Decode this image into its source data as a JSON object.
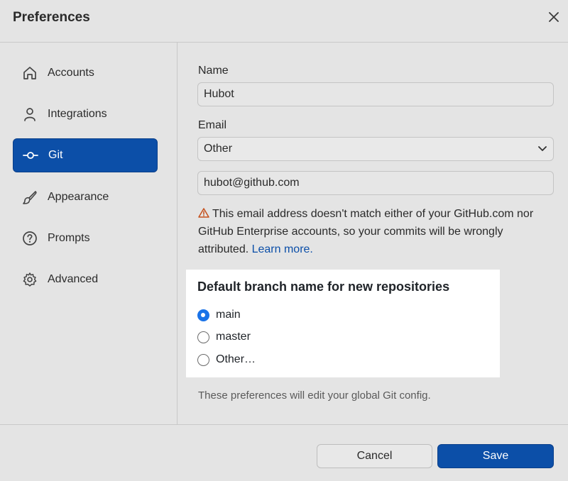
{
  "dialog": {
    "title": "Preferences"
  },
  "sidebar": {
    "items": [
      {
        "label": "Accounts",
        "icon": "home-icon",
        "active": false
      },
      {
        "label": "Integrations",
        "icon": "person-icon",
        "active": false
      },
      {
        "label": "Git",
        "icon": "git-commit-icon",
        "active": true
      },
      {
        "label": "Appearance",
        "icon": "paintbrush-icon",
        "active": false
      },
      {
        "label": "Prompts",
        "icon": "question-circle-icon",
        "active": false
      },
      {
        "label": "Advanced",
        "icon": "gear-icon",
        "active": false
      }
    ]
  },
  "git": {
    "name_label": "Name",
    "name_value": "Hubot",
    "email_label": "Email",
    "email_select_value": "Other",
    "email_value": "hubot@github.com",
    "warning_text": "This email address doesn't match either of your GitHub.com nor GitHub Enterprise accounts, so your commits will be wrongly attributed.",
    "warning_link": "Learn more.",
    "branch_heading": "Default branch name for new repositories",
    "branch_options": [
      {
        "label": "main",
        "checked": true
      },
      {
        "label": "master",
        "checked": false
      },
      {
        "label": "Other…",
        "checked": false
      }
    ],
    "footnote": "These preferences will edit your global Git config."
  },
  "footer": {
    "cancel_label": "Cancel",
    "save_label": "Save"
  },
  "colors": {
    "accent": "#0c4fa8",
    "radio_checked": "#1a73e8",
    "warning": "#c5501c"
  }
}
